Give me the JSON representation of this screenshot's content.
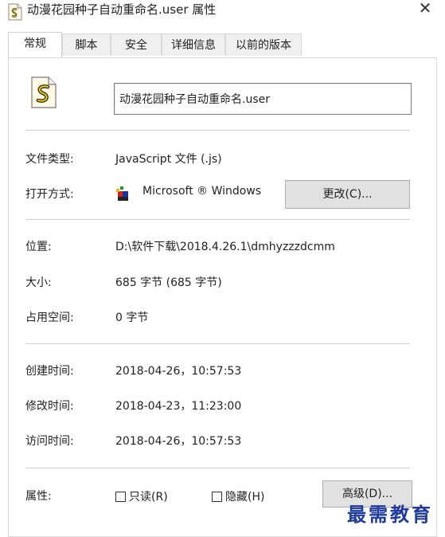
{
  "window": {
    "title": "动漫花园种子自动重命名.user 属性",
    "close_symbol": "✕"
  },
  "tabs": [
    {
      "label": "常规",
      "active": true
    },
    {
      "label": "脚本",
      "active": false
    },
    {
      "label": "安全",
      "active": false
    },
    {
      "label": "详细信息",
      "active": false
    },
    {
      "label": "以前的版本",
      "active": false
    }
  ],
  "general": {
    "file_name": "动漫花园种子自动重命名.user",
    "file_type_label": "文件类型:",
    "file_type_value": "JavaScript 文件 (.js)",
    "open_with_label": "打开方式:",
    "open_with_value": "Microsoft ® Windows",
    "change_button": "更改(C)...",
    "location_label": "位置:",
    "location_value": "D:\\软件下载\\2018.4.26.1\\dmhyzzzdcmm",
    "size_label": "大小:",
    "size_value": "685 字节 (685 字节)",
    "size_on_disk_label": "占用空间:",
    "size_on_disk_value": "0 字节",
    "created_label": "创建时间:",
    "created_value": "2018-04-26，10:57:53",
    "modified_label": "修改时间:",
    "modified_value": "2018-04-23，11:23:00",
    "accessed_label": "访问时间:",
    "accessed_value": "2018-04-26，10:57:53",
    "attributes_label": "属性:",
    "readonly_label": "只读(R)",
    "readonly_checked": false,
    "hidden_label": "隐藏(H)",
    "hidden_checked": false,
    "advanced_button": "高级(D)..."
  },
  "watermark": "最需教育",
  "colors": {
    "watermark": "#1f3a9e",
    "button_bg": "#e1e1e1",
    "separator": "#cfcfcf"
  }
}
